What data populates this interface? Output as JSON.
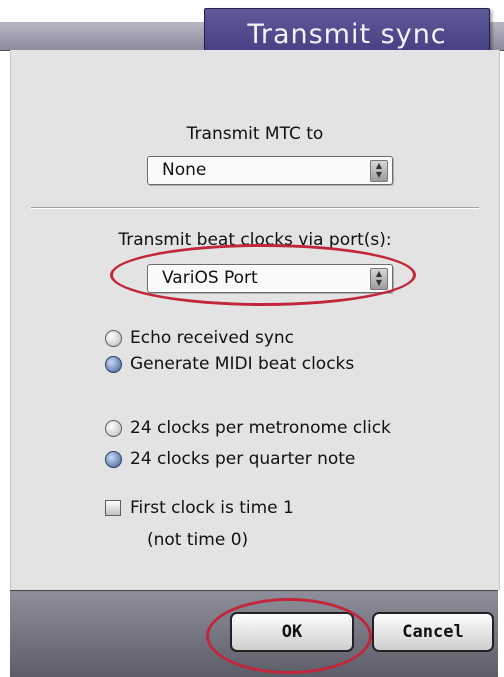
{
  "dialog": {
    "title": "Transmit sync"
  },
  "mtc": {
    "label": "Transmit MTC to",
    "selected": "None"
  },
  "beat_clocks": {
    "label": "Transmit beat clocks via port(s):",
    "selected": "VariOS Port"
  },
  "sync_mode": {
    "options": [
      {
        "label": "Echo received sync",
        "selected": false
      },
      {
        "label": "Generate MIDI beat clocks",
        "selected": true
      }
    ]
  },
  "clock_rate": {
    "options": [
      {
        "label": "24 clocks per metronome click",
        "selected": false
      },
      {
        "label": "24 clocks per quarter note",
        "selected": true
      }
    ]
  },
  "first_clock": {
    "label": "First clock is time 1",
    "sublabel": "(not time 0)",
    "checked": false
  },
  "buttons": {
    "ok": "OK",
    "cancel": "Cancel"
  },
  "colors": {
    "title_bg": "#4b4689",
    "highlight_ring": "#c2263a",
    "radio_selected": "#3d5f9e"
  }
}
